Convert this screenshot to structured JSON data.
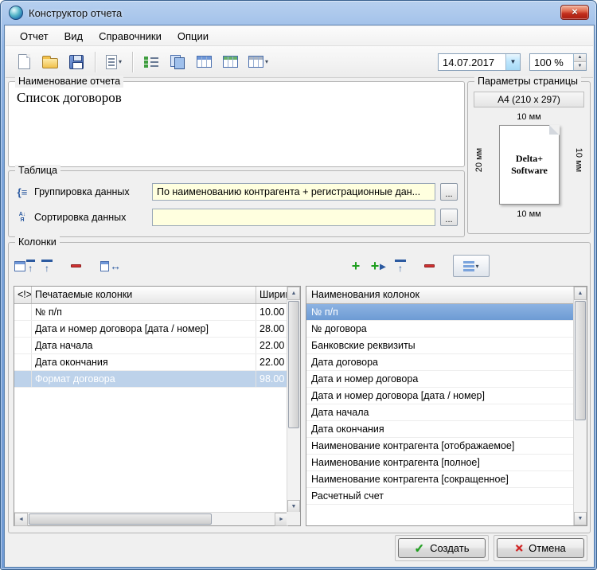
{
  "window": {
    "title": "Конструктор отчета",
    "close_glyph": "×"
  },
  "menu": {
    "items": [
      "Отчет",
      "Вид",
      "Справочники",
      "Опции"
    ]
  },
  "toolbar": {
    "date_value": "14.07.2017",
    "zoom_value": "100 %"
  },
  "report_name": {
    "label": "Наименование отчета",
    "value": "Список договоров"
  },
  "page_params": {
    "label": "Параметры страницы",
    "format": "A4 (210 x 297)",
    "margin_top": "10 мм",
    "margin_bottom": "10 мм",
    "margin_left": "20 мм",
    "margin_right": "10 мм",
    "watermark_line1": "Delta+",
    "watermark_line2": "Software"
  },
  "table_group": {
    "label": "Таблица",
    "grouping_label": "Группировка данных",
    "grouping_value": "По наименованию контрагента + регистрационные дан...",
    "sorting_label": "Сортировка данных",
    "sorting_value": "",
    "browse_label": "..."
  },
  "columns": {
    "label": "Колонки",
    "printed": {
      "headers": {
        "marker": "<!>",
        "name": "Печатаемые колонки",
        "width": "Ширина"
      },
      "rows": [
        {
          "name": "№ п/п",
          "width": "10.00",
          "selected": false
        },
        {
          "name": "Дата и номер договора [дата / номер]",
          "width": "28.00",
          "selected": false
        },
        {
          "name": "Дата начала",
          "width": "22.00",
          "selected": false
        },
        {
          "name": "Дата окончания",
          "width": "22.00",
          "selected": false
        },
        {
          "name": "Формат договора",
          "width": "98.00",
          "selected": true
        }
      ]
    },
    "available": {
      "header": "Наименования колонок",
      "items": [
        {
          "label": "№ п/п",
          "selected": true
        },
        {
          "label": "№ договора",
          "selected": false
        },
        {
          "label": "Банковские реквизиты",
          "selected": false
        },
        {
          "label": "Дата договора",
          "selected": false
        },
        {
          "label": "Дата и номер договора",
          "selected": false
        },
        {
          "label": "Дата и номер договора [дата / номер]",
          "selected": false
        },
        {
          "label": "Дата начала",
          "selected": false
        },
        {
          "label": "Дата окончания",
          "selected": false
        },
        {
          "label": "Наименование контрагента [отображаемое]",
          "selected": false
        },
        {
          "label": "Наименование контрагента [полное]",
          "selected": false
        },
        {
          "label": "Наименование контрагента [сокращенное]",
          "selected": false
        },
        {
          "label": "Расчетный счет",
          "selected": false
        }
      ]
    }
  },
  "footer": {
    "create": "Создать",
    "cancel": "Отмена"
  }
}
